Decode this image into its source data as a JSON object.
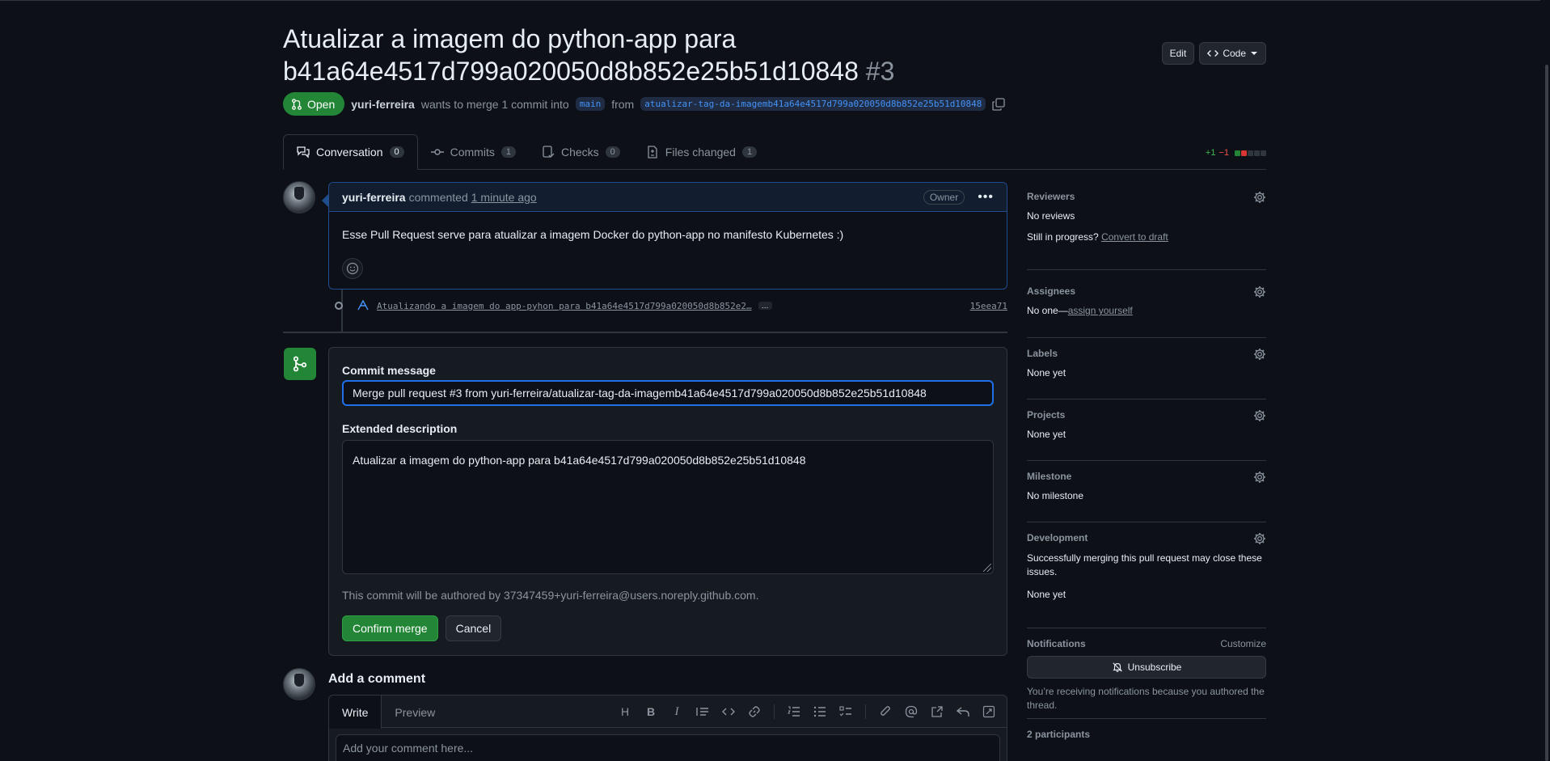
{
  "pr": {
    "title_line1": "Atualizar a imagem do python-app para",
    "title_line2": "b41a64e4517d799a020050d8b852e25b51d10848",
    "number": "#3",
    "state": "Open",
    "author": "yuri-ferreira",
    "merge_text": "wants to merge 1 commit into",
    "base_branch": "main",
    "from_text": "from",
    "head_branch": "atualizar-tag-da-imagemb41a64e4517d799a020050d8b852e25b51d10848"
  },
  "header_buttons": {
    "edit": "Edit",
    "code": "Code"
  },
  "tabs": [
    {
      "label": "Conversation",
      "count": "0"
    },
    {
      "label": "Commits",
      "count": "1"
    },
    {
      "label": "Checks",
      "count": "0"
    },
    {
      "label": "Files changed",
      "count": "1"
    }
  ],
  "diffstat": {
    "additions": "+1",
    "deletions": "−1"
  },
  "comment": {
    "author": "yuri-ferreira",
    "action": "commented",
    "time": "1 minute ago",
    "badge": "Owner",
    "body": "Esse Pull Request serve para atualizar a imagem Docker do python-app no manifesto Kubernetes :)"
  },
  "commit": {
    "message": "Atualizando a imagem do app-pyhon para b41a64e4517d799a020050d8b852e2…",
    "ellipsis": "…",
    "sha": "15eea71"
  },
  "merge": {
    "commit_message_label": "Commit message",
    "commit_message": "Merge pull request #3 from yuri-ferreira/atualizar-tag-da-imagemb41a64e4517d799a020050d8b852e25b51d10848",
    "extended_label": "Extended description",
    "extended": "Atualizar a imagem do python-app para b41a64e4517d799a020050d8b852e25b51d10848",
    "author_note": "This commit will be authored by 37347459+yuri-ferreira@users.noreply.github.com.",
    "confirm": "Confirm merge",
    "cancel": "Cancel"
  },
  "add_comment": {
    "title": "Add a comment",
    "write_tab": "Write",
    "preview_tab": "Preview",
    "placeholder": "Add your comment here..."
  },
  "sidebar": {
    "reviewers": {
      "title": "Reviewers",
      "value": "No reviews",
      "in_progress": "Still in progress?",
      "convert": "Convert to draft"
    },
    "assignees": {
      "title": "Assignees",
      "value": "No one—",
      "assign": "assign yourself"
    },
    "labels": {
      "title": "Labels",
      "value": "None yet"
    },
    "projects": {
      "title": "Projects",
      "value": "None yet"
    },
    "milestone": {
      "title": "Milestone",
      "value": "No milestone"
    },
    "development": {
      "title": "Development",
      "note": "Successfully merging this pull request may close these issues.",
      "value": "None yet"
    },
    "notifications": {
      "title": "Notifications",
      "customize": "Customize",
      "unsubscribe": "Unsubscribe",
      "note": "You’re receiving notifications because you authored the thread."
    },
    "participants": {
      "title": "2 participants"
    }
  },
  "colors": {
    "accent_green": "#238636",
    "accent_blue": "#1f6feb",
    "background": "#0d1117"
  }
}
